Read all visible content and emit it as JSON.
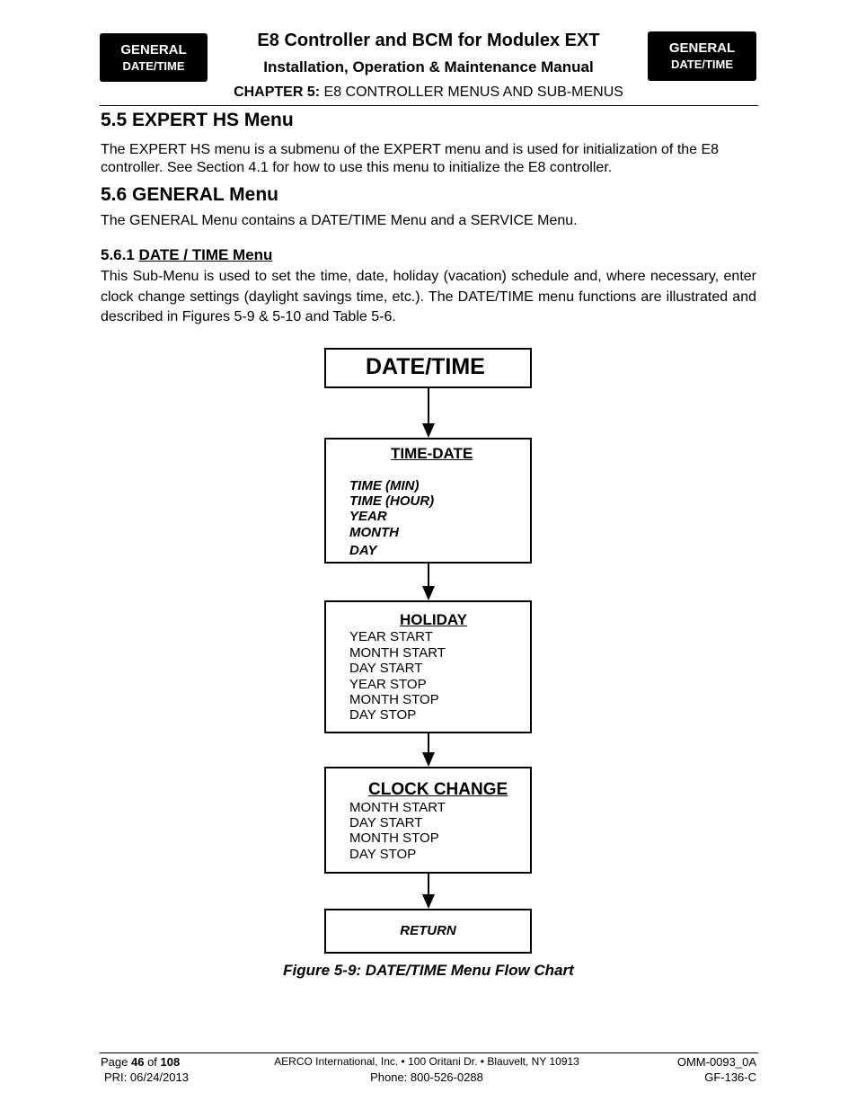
{
  "header": {
    "left_tag": {
      "line1": "GENERAL",
      "line2": "DATE/TIME"
    },
    "right_tag": {
      "line1": "GENERAL",
      "line2": "DATE/TIME"
    },
    "title": "E8 Controller and BCM for Modulex EXT",
    "subtitle": "Installation, Operation & Maintenance Manual",
    "chapter_label": "CHAPTER 5:",
    "chapter_text": " E8 CONTROLLER MENUS AND SUB-MENUS"
  },
  "sections": {
    "s55": {
      "heading": "5.5  EXPERT HS Menu",
      "body": "The EXPERT HS menu is a submenu of the EXPERT menu and is used for initialization of the E8 controller. See Section 4.1 for how to use this menu to initialize the E8 controller."
    },
    "s56": {
      "heading": "5.6  GENERAL Menu",
      "body": "The GENERAL Menu contains a DATE/TIME Menu and a SERVICE Menu."
    },
    "s561": {
      "number": "5.6.1 ",
      "title": "DATE / TIME Menu",
      "body": "This Sub-Menu is used to set the time, date, holiday (vacation) schedule and, where necessary, enter clock change settings (daylight savings time, etc.). The DATE/TIME menu functions are illustrated and described in Figures 5-9 & 5-10 and Table 5-6."
    }
  },
  "flowchart": {
    "root": "DATE/TIME",
    "time_date": {
      "title": "TIME-DATE",
      "items": [
        "TIME (MIN)",
        "TIME (HOUR)",
        "YEAR",
        "MONTH",
        "DAY"
      ]
    },
    "holiday": {
      "title": "HOLIDAY",
      "items": [
        "YEAR START",
        "MONTH START",
        "DAY START",
        "YEAR STOP",
        "MONTH STOP",
        "DAY STOP"
      ]
    },
    "clock_change": {
      "title": "CLOCK CHANGE",
      "items": [
        "MONTH START",
        "DAY START",
        "MONTH STOP",
        "DAY STOP"
      ]
    },
    "return": "RETURN",
    "caption": "Figure 5-9:  DATE/TIME Menu Flow Chart"
  },
  "footer": {
    "page_prefix": "Page ",
    "page_number": "46",
    "page_of": " of ",
    "page_total": "108",
    "pri": "PRI:  06/24/2013",
    "company": "AERCO International, Inc. • 100 Oritani Dr. •  Blauvelt, NY 10913",
    "phone": "Phone: 800-526-0288",
    "doc_number": "OMM-0093_0A",
    "form_number": "GF-136-C"
  }
}
